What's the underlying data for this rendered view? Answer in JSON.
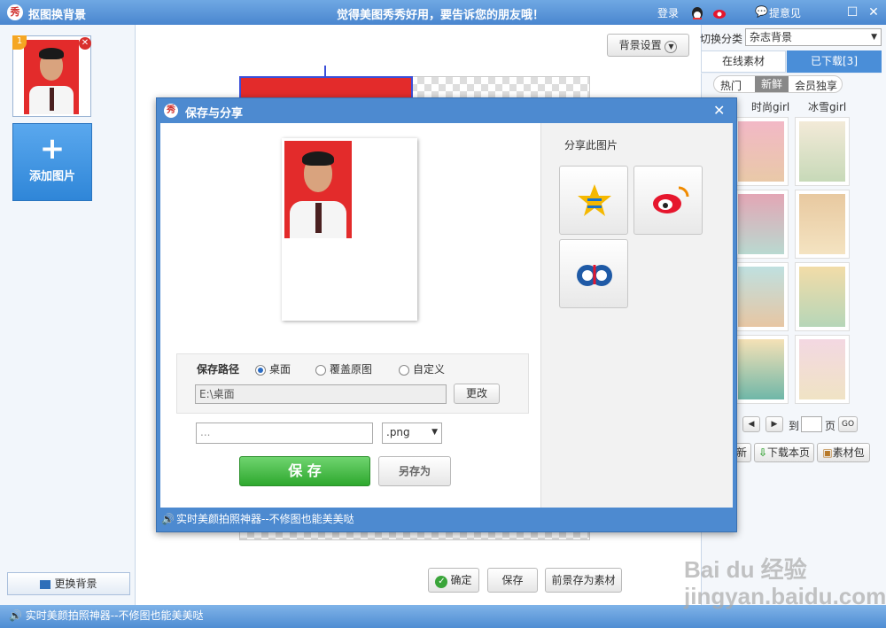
{
  "window": {
    "title": "抠图换背景",
    "slogan": "觉得美图秀秀好用，要告诉您的朋友哦！",
    "login": "登录",
    "feedback": "提意见",
    "logo_char": "秀"
  },
  "left": {
    "thumb_index": "1",
    "add_label": "添加图片",
    "change_bg_label": "更换背景"
  },
  "canvas": {
    "bg_settings_label": "背景设置",
    "confirm_label": "确定",
    "save_label": "保存",
    "save_fg_label": "前景存为素材"
  },
  "right": {
    "switch_label": "切换分类",
    "category_value": "杂志背景",
    "tabs": [
      "在线素材",
      "已下载[3]"
    ],
    "subtabs": [
      "热门",
      "新鲜",
      "会员独享"
    ],
    "tags": [
      "时尚girl",
      "冰雪girl"
    ],
    "goto_label": "到",
    "page_label": "页",
    "go_label": "GO",
    "refresh_label": "新",
    "download_page_label": "下载本页",
    "pack_label": "素材包"
  },
  "dialog": {
    "title": "保存与分享",
    "share_title": "分享此图片",
    "path_label": "保存路径",
    "options": [
      "桌面",
      "覆盖原图",
      "自定义"
    ],
    "path_value": "E:\\桌面",
    "change_label": "更改",
    "filename_value": "...",
    "format_value": ".png",
    "save_label": "保 存",
    "save_as_label": "另存为",
    "footer_text": "实时美颜拍照神器--不修图也能美美哒"
  },
  "status_text": "实时美颜拍照神器--不修图也能美美哒",
  "watermark": "Bai du 经验 jingyan.baidu.com"
}
